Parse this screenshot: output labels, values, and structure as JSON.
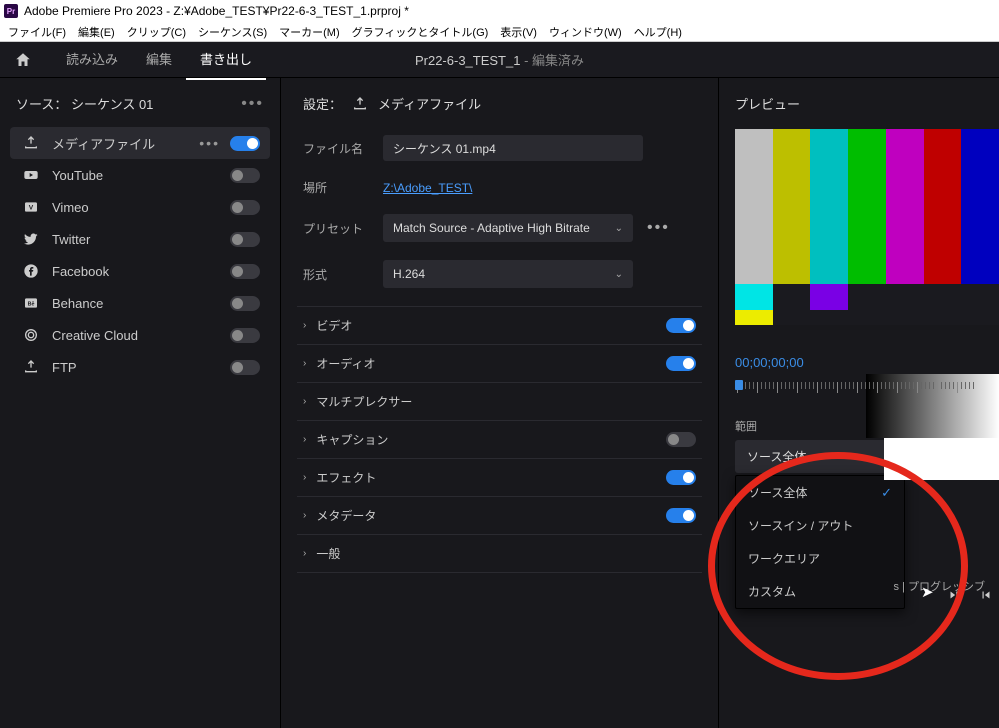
{
  "titlebar": {
    "app_icon_text": "Pr",
    "title": "Adobe Premiere Pro 2023 - Z:¥Adobe_TEST¥Pr22-6-3_TEST_1.prproj *"
  },
  "menubar": {
    "items": [
      "ファイル(F)",
      "編集(E)",
      "クリップ(C)",
      "シーケンス(S)",
      "マーカー(M)",
      "グラフィックとタイトル(G)",
      "表示(V)",
      "ウィンドウ(W)",
      "ヘルプ(H)"
    ]
  },
  "topnav": {
    "tabs": {
      "import": "読み込み",
      "edit": "編集",
      "export": "書き出し"
    },
    "active_tab": "export",
    "project": {
      "name": "Pr22-6-3_TEST_1",
      "suffix": " - 編集済み"
    }
  },
  "left": {
    "source_label": "ソース：",
    "source_value": "シーケンス 01",
    "destinations": [
      {
        "key": "media",
        "label": "メディアファイル",
        "icon": "export",
        "on": true,
        "moreDots": true
      },
      {
        "key": "youtube",
        "label": "YouTube",
        "icon": "youtube",
        "on": false
      },
      {
        "key": "vimeo",
        "label": "Vimeo",
        "icon": "vimeo",
        "on": false
      },
      {
        "key": "twitter",
        "label": "Twitter",
        "icon": "twitter",
        "on": false
      },
      {
        "key": "facebook",
        "label": "Facebook",
        "icon": "facebook",
        "on": false
      },
      {
        "key": "behance",
        "label": "Behance",
        "icon": "behance",
        "on": false
      },
      {
        "key": "cc",
        "label": "Creative Cloud",
        "icon": "cc",
        "on": false
      },
      {
        "key": "ftp",
        "label": "FTP",
        "icon": "ftp",
        "on": false
      }
    ]
  },
  "settings": {
    "header_label": "設定：",
    "header_value": "メディアファイル",
    "filename_label": "ファイル名",
    "filename_value": "シーケンス 01.mp4",
    "location_label": "場所",
    "location_value": "Z:\\Adobe_TEST\\",
    "preset_label": "プリセット",
    "preset_value": "Match Source - Adaptive High Bitrate",
    "format_label": "形式",
    "format_value": "H.264",
    "sections": [
      {
        "key": "video",
        "label": "ビデオ",
        "toggle": true,
        "on": true
      },
      {
        "key": "audio",
        "label": "オーディオ",
        "toggle": true,
        "on": true
      },
      {
        "key": "mux",
        "label": "マルチプレクサー",
        "toggle": false
      },
      {
        "key": "caption",
        "label": "キャプション",
        "toggle": true,
        "on": false
      },
      {
        "key": "effects",
        "label": "エフェクト",
        "toggle": true,
        "on": true
      },
      {
        "key": "metadata",
        "label": "メタデータ",
        "toggle": true,
        "on": true
      },
      {
        "key": "general",
        "label": "一般",
        "toggle": false
      }
    ]
  },
  "preview": {
    "header": "プレビュー",
    "timecode": "00;00;00;00",
    "range_label": "範囲",
    "range_selected": "ソース全体",
    "range_options": [
      "ソース全体",
      "ソースイン / アウト",
      "ワークエリア",
      "カスタム"
    ],
    "footer_fragment": "s | プログレッシブ"
  },
  "colors": {
    "bars_top": [
      "#bfbfbf",
      "#bdbf00",
      "#00bfbf",
      "#00bd00",
      "#bf00bf",
      "#bf0000",
      "#0000bf"
    ],
    "bars_mid": [
      "#00e5e5",
      "#1a1a1f",
      "#7a00e5",
      "#1a1a1f",
      "#1a1a1f",
      "#1a1a1f",
      "#1a1a1f"
    ],
    "bars_bot": [
      "#ecec00",
      "#1a1a1f",
      "#1a1a1f",
      "#1a1a1f",
      "#1a1a1f",
      "#1a1a1f",
      "#1a1a1f"
    ]
  }
}
